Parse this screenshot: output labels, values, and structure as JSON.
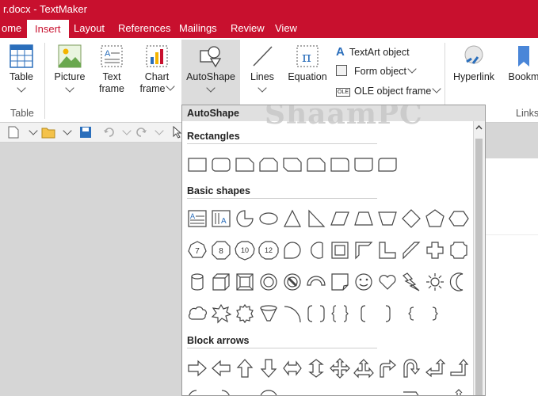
{
  "window": {
    "title": "r.docx - TextMaker"
  },
  "tabs": [
    {
      "label": "ome"
    },
    {
      "label": "Insert"
    },
    {
      "label": "Layout"
    },
    {
      "label": "References"
    },
    {
      "label": "Mailings"
    },
    {
      "label": "Review"
    },
    {
      "label": "View"
    }
  ],
  "ribbon": {
    "table": {
      "label": "Table",
      "group": "Table"
    },
    "picture": {
      "label": "Picture"
    },
    "textframe": {
      "line1": "Text",
      "line2": "frame"
    },
    "chartframe": {
      "line1": "Chart",
      "line2": "frame"
    },
    "autoshape": {
      "label": "AutoShape"
    },
    "lines": {
      "label": "Lines"
    },
    "equation": {
      "label": "Equation"
    },
    "textart": {
      "label": "TextArt object"
    },
    "formobj": {
      "label": "Form object"
    },
    "oleobj": {
      "label": "OLE object frame"
    },
    "hyperlink": {
      "label": "Hyperlink"
    },
    "bookmark": {
      "label": "Bookm"
    },
    "links": {
      "group": "Links"
    }
  },
  "dropdown": {
    "title": "AutoShape",
    "watermark": "ShaamPC",
    "sections": {
      "rectangles": "Rectangles",
      "basic": "Basic shapes",
      "arrows": "Block arrows"
    },
    "numbers": [
      "7",
      "8",
      "10",
      "12"
    ]
  },
  "colors": {
    "accent": "#c8102e",
    "ribbon_bg": "#ffffff",
    "icon_blue": "#2a6ebb"
  }
}
